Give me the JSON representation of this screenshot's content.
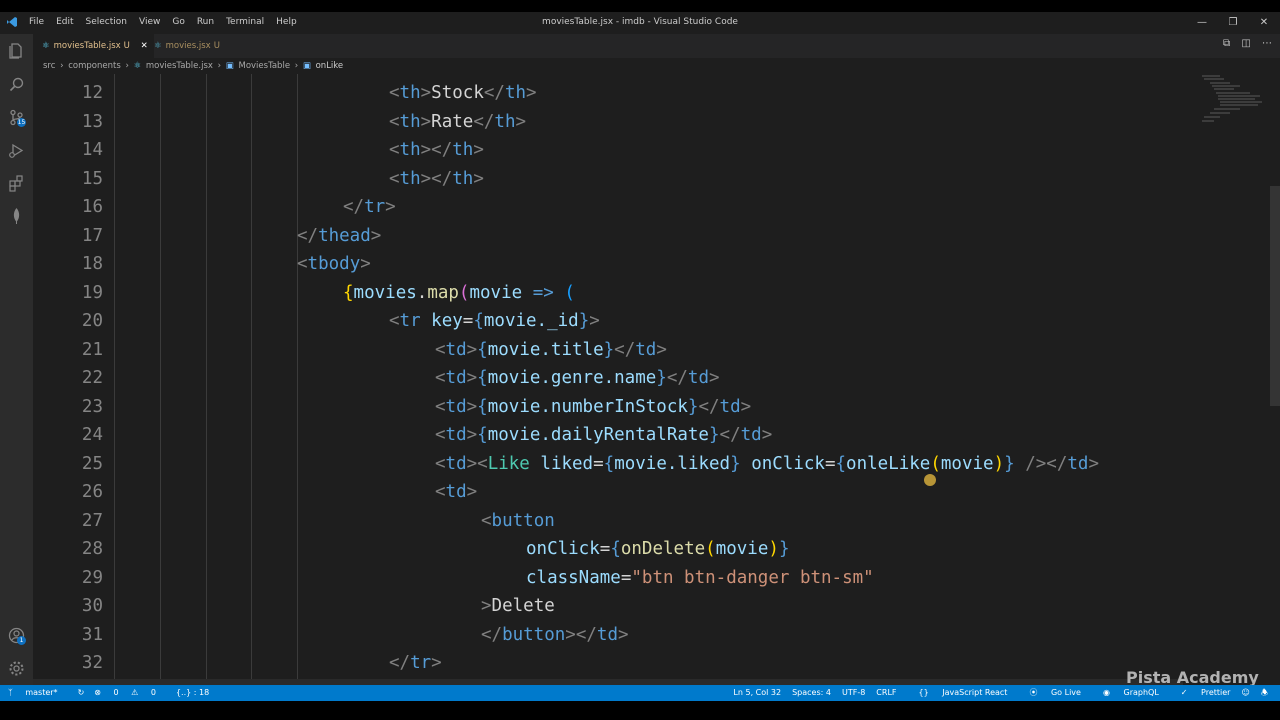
{
  "window": {
    "title": "moviesTable.jsx - imdb - Visual Studio Code",
    "menu": [
      "File",
      "Edit",
      "Selection",
      "View",
      "Go",
      "Run",
      "Terminal",
      "Help"
    ]
  },
  "tabs": [
    {
      "label": "moviesTable.jsx",
      "status": "U",
      "active": true
    },
    {
      "label": "movies.jsx",
      "status": "U",
      "active": false
    }
  ],
  "breadcrumb": [
    "src",
    "components",
    "moviesTable.jsx",
    "MoviesTable",
    "onLike"
  ],
  "activity_badges": {
    "scm": "15",
    "accounts": "1"
  },
  "line_numbers": [
    "12",
    "13",
    "14",
    "15",
    "16",
    "17",
    "18",
    "19",
    "20",
    "21",
    "22",
    "23",
    "24",
    "25",
    "26",
    "27",
    "28",
    "29",
    "30",
    "31",
    "32"
  ],
  "code": {
    "l12": "Stock",
    "l13": "Rate",
    "l19_movies": "movies",
    "l19_map": "map",
    "l19_param": "movie",
    "l19_arrow": "=>",
    "l20_key": "key",
    "l20_val": "movie._id",
    "l21": "movie.title",
    "l22": "movie.genre.name",
    "l23": "movie.numberInStock",
    "l24": "movie.dailyRentalRate",
    "l25_comp": "Like",
    "l25_liked": "liked",
    "l25_liked_val": "movie.liked",
    "l25_onclick": "onClick",
    "l25_fn": "onleLike",
    "l25_arg": "movie",
    "l27_tag": "button",
    "l28_attr": "onClick",
    "l28_fn": "onDelete",
    "l28_arg": "movie",
    "l29_attr": "className",
    "l29_val": "\"btn btn-danger btn-sm\"",
    "l30_text": "Delete",
    "l31_tag": "button"
  },
  "status": {
    "branch": "master*",
    "errors": "0",
    "warnings": "0",
    "selection": "{..} : 18",
    "position": "Ln 5, Col 32",
    "spaces": "Spaces: 4",
    "encoding": "UTF-8",
    "eol": "CRLF",
    "language": "JavaScript React",
    "golive": "Go Live",
    "graphql": "GraphQL",
    "prettier": "Prettier"
  },
  "watermark": "Pista Academy",
  "colors": {
    "accent": "#007acc",
    "editor_bg": "#1e1e1e",
    "tag": "#569cd6",
    "attr": "#9cdcfe",
    "string": "#ce9178"
  }
}
